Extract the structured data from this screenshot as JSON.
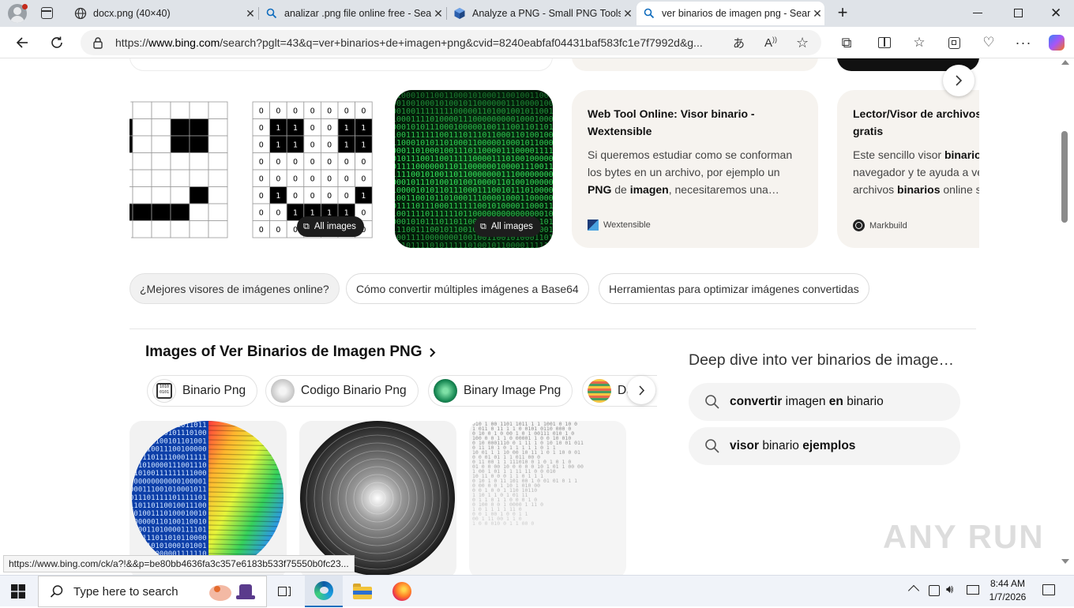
{
  "browser": {
    "tabs": [
      {
        "title": "docx.png (40×40)",
        "icon": "globe-icon",
        "active": false
      },
      {
        "title": "analizar .png file online free - Sear",
        "icon": "search-icon",
        "active": false
      },
      {
        "title": "Analyze a PNG - Small PNG Tools",
        "icon": "cube-icon",
        "active": false
      },
      {
        "title": "ver binarios de imagen png - Sear",
        "icon": "search-icon",
        "active": true
      }
    ],
    "new_tab_label": "+",
    "url_prefix": "https://",
    "url_host": "www.bing.com",
    "url_path": "/search?pglt=43&q=ver+binarios+de+imagen+png&cvid=8240eabfaf04431baf583fc1e7f7992d&g..."
  },
  "results": {
    "cards": [
      {
        "type": "image",
        "badge": "All images"
      },
      {
        "type": "image",
        "badge": "All images"
      },
      {
        "type": "text",
        "title_line1": "Web Tool Online: Visor binario -",
        "title_line2": "Wextensible",
        "body_line1": "Si queremos estudiar como se conforman",
        "body_line2": "los bytes en un archivo, por ejemplo un",
        "body_line3_bold1": "PNG",
        "body_line3_mid": " de ",
        "body_line3_bold2": "imagen",
        "body_line3_tail": ", necesitaremos una…",
        "source": "Wextensible"
      },
      {
        "type": "text",
        "title_line1": "Lector/Visor de archivos b",
        "title_line2": "gratis",
        "body_line1_pre": "Este sencillo visor ",
        "body_line1_bold": "binario",
        "body_line2": "navegador y te ayuda a ve",
        "body_line3_pre": "archivos ",
        "body_line3_bold": "binarios",
        "body_line3_tail": " online s",
        "source": "Markbuild"
      }
    ],
    "related_chips": [
      "¿Mejores visores de imágenes online?",
      "Cómo convertir múltiples imágenes a Base64",
      "Herramientas para optimizar imágenes convertidas"
    ]
  },
  "images_section": {
    "heading": "Images of Ver Binarios de Imagen PNG",
    "pills": [
      "Binario Png",
      "Codigo Binario Png",
      "Binary Image Png",
      "Da"
    ]
  },
  "deep_dive": {
    "heading": "Deep dive into ver binarios de image…",
    "queries": [
      {
        "bold1": "convertir",
        "mid1": " imagen ",
        "bold2": "en",
        "tail": " binario"
      },
      {
        "bold1": "visor",
        "mid1": " binario ",
        "bold2": "ejemplos",
        "tail": ""
      }
    ]
  },
  "status_url": "https://www.bing.com/ck/a?!&&p=be80bb4636fa3c357e6183b533f75550b0fc23...",
  "watermark": "ANY RUN",
  "taskbar": {
    "search_placeholder": "Type here to search",
    "time": "8:44 AM",
    "date": "1/7/2026"
  },
  "colors": {
    "accent": "#0f6cbd",
    "tabbar": "#dfe3e8",
    "taskbar": "#f0f3f9"
  }
}
